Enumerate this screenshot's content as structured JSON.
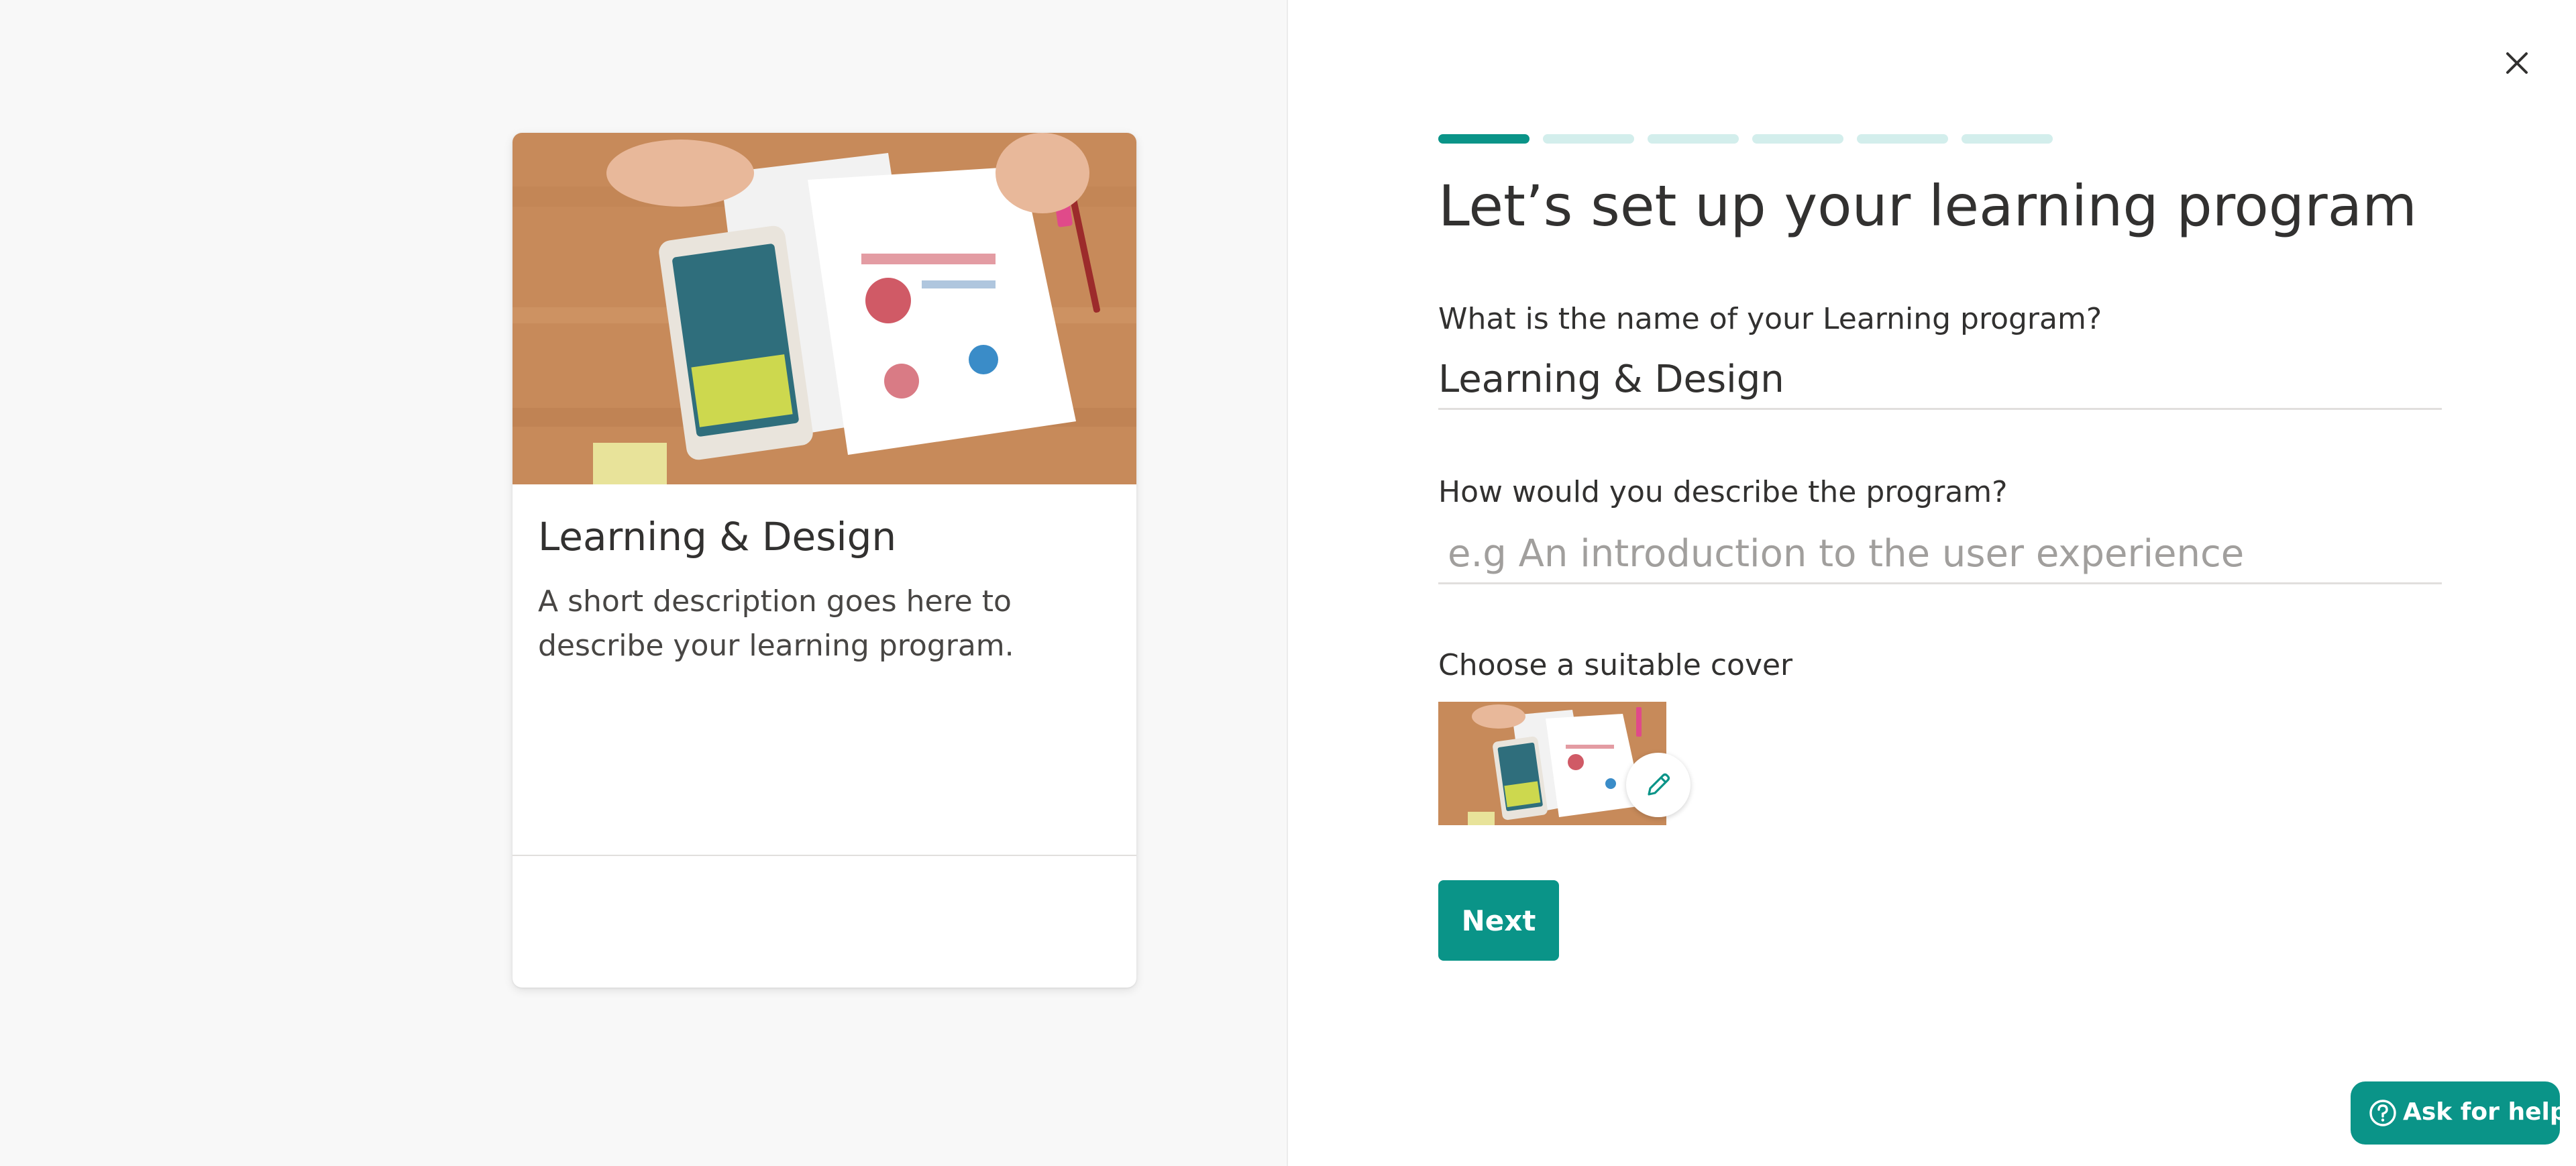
{
  "preview": {
    "title": "Learning & Design",
    "description": "A short description goes here to describe your learning program."
  },
  "wizard": {
    "steps_total": 6,
    "current_step": 1,
    "title": "Let’s set up your learning program",
    "name_label": "What is the name of your Learning program?",
    "name_value": "Learning & Design",
    "desc_label": "How would you describe the program?",
    "desc_placeholder": "e.g An introduction to the user experience",
    "cover_label": "Choose a suitable cover",
    "next_label": "Next"
  },
  "help": {
    "label": "Ask for help"
  },
  "icons": {
    "close": "close-icon",
    "edit": "pencil-icon",
    "help": "question-circle-icon"
  },
  "colors": {
    "accent": "#0a9488",
    "accent_light": "#d3eeec",
    "left_bg": "#f8f8f8"
  }
}
